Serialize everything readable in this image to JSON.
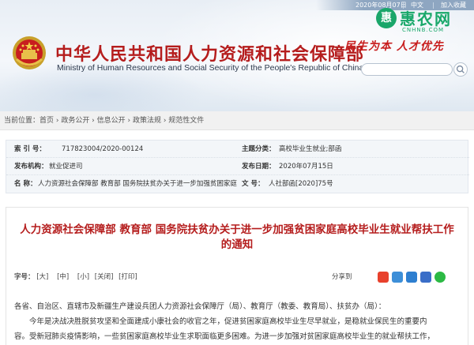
{
  "topbar": {
    "date": "2020年08月07日",
    "sep": "|",
    "lang": "中文",
    "favorite": "加入收藏"
  },
  "watermark": {
    "logo": "惠",
    "name": "惠农网",
    "sub": "CNHNB.COM"
  },
  "header": {
    "title_cn": "中华人民共和国人力资源和社会保障部",
    "title_en": "Ministry of Human Resources and Social Security of the People's Republic of China",
    "slogan": "民生为本 人才优先"
  },
  "breadcrumb": "当前位置：首页 › 政务公开 › 信息公开 › 政策法规 › 规范性文件",
  "meta": {
    "row1": {
      "k1": "索 引 号：",
      "v1": "717823004/2020-00124",
      "k2": "主题分类：",
      "v2": "高校毕业生就业;部函"
    },
    "row2": {
      "k1": "发布机构：",
      "v1": "就业促进司",
      "k2": "发布日期：",
      "v2": "2020年07月15日"
    },
    "row3": {
      "k1": "名 称：",
      "v1": "人力资源社会保障部 教育部 国务院扶贫办关于进一步加强贫困家庭",
      "k2": "文 号：",
      "v2": "人社部函[2020]75号"
    }
  },
  "article": {
    "headline_line1": "人力资源社会保障部 教育部 国务院扶贫办关于进一步加强贫困家庭高校毕业生就业帮扶工作",
    "headline_line2": "的通知",
    "font_label": "字号：",
    "font_large": "[大]",
    "font_medium": "[中]",
    "font_small": "[小]",
    "close": "[关闭]",
    "print": "[打印]",
    "share": "分享到",
    "p1": "各省、自治区、直辖市及新疆生产建设兵团人力资源社会保障厅（局）、教育厅（教委、教育局）、扶贫办（局）：",
    "p2a": "今年是决战决胜脱贫攻坚和全面建成小康社会的收官之年，促进贫困家庭高校毕业生尽早就业，是稳就业保民生的重要内",
    "p2b": "容。受新冠肺炎疫情影响，一些贫困家庭高校毕业生求职面临更多困难。为进一步加强对贫困家庭高校毕业生的就业帮扶工作，"
  },
  "colors": {
    "title_red": "#b51d1d",
    "brand_green": "#19a86a"
  }
}
